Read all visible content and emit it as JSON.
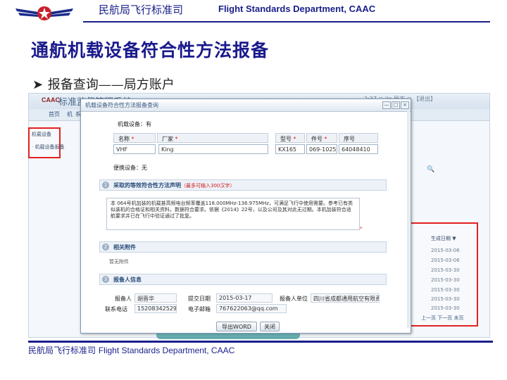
{
  "header": {
    "org_cn": "民航局飞行标准司",
    "org_en": "Flight Standards Department, CAAC"
  },
  "slide": {
    "title": "通航机载设备符合性方法报备",
    "bullet": "报备查询——局方账户"
  },
  "background_app": {
    "logo_text": "CAAC",
    "system_title": "标准监督管理系统",
    "user_info": "2:37 ○ lin 局方 ○ 【退出】",
    "nav_items": [
      "首页",
      "机",
      "系"
    ],
    "left_menu": [
      "机载设备",
      "· 机载设备报备"
    ],
    "list_column": "生成日期 ▼",
    "list_dates": [
      "2015-03-06",
      "2015-03-06",
      "2015-03-30",
      "2015-03-30",
      "2015-03-30",
      "2015-03-30",
      "2015-03-30"
    ],
    "pager": "上一页 下一页 末页",
    "search_icon": "magnifier-icon"
  },
  "dialog": {
    "title": "机载设备符合性方法报备查询",
    "window_buttons": [
      "—",
      "□",
      "×"
    ],
    "equipment_installed": "机载设备：有",
    "table_headers": [
      "名称",
      "厂家",
      "型号",
      "件号",
      "序号"
    ],
    "table_values": [
      "VHF",
      "King",
      "KX165",
      "069-1025",
      "64048410"
    ],
    "portable_equipment": "便携设备：无",
    "section1": {
      "num": "1",
      "title": "采取的等效符合性方法声明",
      "hint": "（最多可输入300汉字）"
    },
    "declaration": "本 064号机加装的机载甚高频电台频率覆盖118.000MHz-136.975MHz，可满足飞行中使用需要。参考已有类似装机的合格证和相关资料，数据符合要求。依据《2014》22号，以及公司及其对此无过期。本机加装符合适航要求并已在飞行中验证通过了批复。",
    "section2": {
      "num": "2",
      "title": "相关附件"
    },
    "attachment_text": "暂无附件",
    "section3": {
      "num": "3",
      "title": "报备人信息"
    },
    "submitter_label": "报备人",
    "submitter_value": "胡晋华",
    "date_label": "提交日期",
    "date_value": "2015-03-17",
    "unit_label": "报备人单位",
    "unit_value": "四川省成都通用航空有限责任",
    "phone_label": "联系电话",
    "phone_value": "15208342529",
    "email_label": "电子邮箱",
    "email_value": "767622063@qq.com",
    "export_button": "导出WORD",
    "close_button": "关闭"
  },
  "footer": {
    "text_cn": "民航局飞行标准司",
    "text_en": "Flight Standards Department, CAAC"
  },
  "colors": {
    "brand_blue": "#1a1f8a",
    "highlight_red": "#e42121"
  }
}
